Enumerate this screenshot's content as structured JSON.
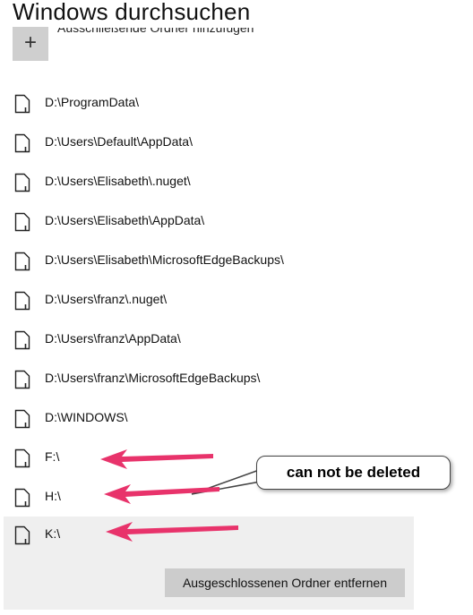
{
  "header": {
    "title": "Windows durchsuchen",
    "add_button_icon": "plus-icon",
    "add_button_label": "Ausschließende Ordner hinzufügen"
  },
  "excluded_folders": [
    {
      "path": "D:\\ProgramData\\",
      "icon": "folder-icon"
    },
    {
      "path": "D:\\Users\\Default\\AppData\\",
      "icon": "folder-icon"
    },
    {
      "path": "D:\\Users\\Elisabeth\\.nuget\\",
      "icon": "folder-icon"
    },
    {
      "path": "D:\\Users\\Elisabeth\\AppData\\",
      "icon": "folder-icon"
    },
    {
      "path": "D:\\Users\\Elisabeth\\MicrosoftEdgeBackups\\",
      "icon": "folder-icon"
    },
    {
      "path": "D:\\Users\\franz\\.nuget\\",
      "icon": "folder-icon"
    },
    {
      "path": "D:\\Users\\franz\\AppData\\",
      "icon": "folder-icon"
    },
    {
      "path": "D:\\Users\\franz\\MicrosoftEdgeBackups\\",
      "icon": "folder-icon"
    },
    {
      "path": "D:\\WINDOWS\\",
      "icon": "folder-icon"
    },
    {
      "path": "F:\\",
      "icon": "folder-icon"
    },
    {
      "path": "H:\\",
      "icon": "folder-icon"
    },
    {
      "path": "K:\\",
      "icon": "folder-icon",
      "selected": true
    }
  ],
  "remove_button_label": "Ausgeschlossenen Ordner entfernen",
  "annotation": {
    "callout_text": "can not be deleted",
    "arrow_color": "#e8336b"
  },
  "colors": {
    "selected_row": "#efefef",
    "button_bg": "#cccccc",
    "add_tile_bg": "#cfcfcf"
  }
}
